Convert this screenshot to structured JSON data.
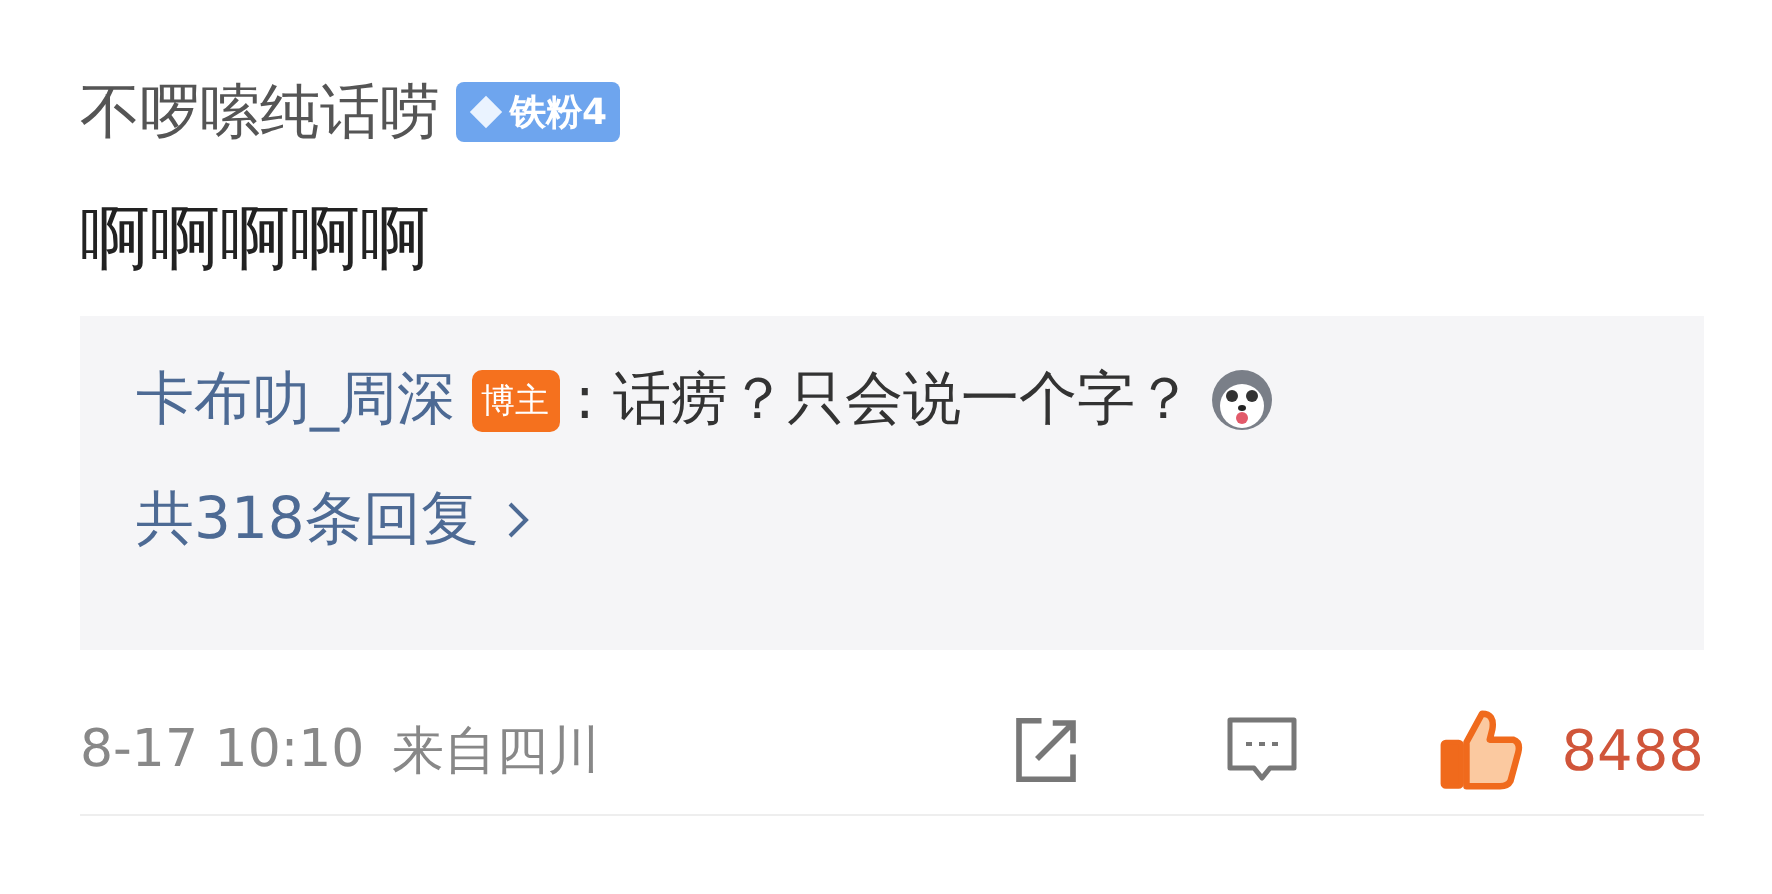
{
  "comment": {
    "username": "不啰嗦纯话唠",
    "fan_badge": "铁粉4",
    "text": "啊啊啊啊啊"
  },
  "reply_box": {
    "author": "卡布叻_周深",
    "author_badge": "博主",
    "text": ": 话痨？只会说一个字？",
    "more": "共318条回复"
  },
  "footer": {
    "time": "8-17 10:10",
    "location": "来自四川",
    "likes": "8488",
    "liked": true
  }
}
